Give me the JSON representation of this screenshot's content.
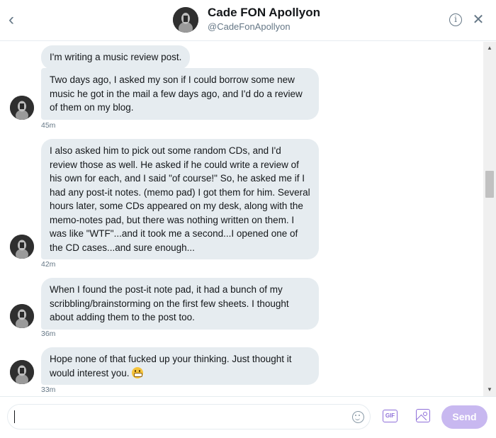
{
  "header": {
    "back_icon": "chevron-left-icon",
    "name": "Cade FON Apollyon",
    "handle": "@CadeFonApollyon",
    "info_icon": "info-icon",
    "close_icon": "close-icon"
  },
  "messages": [
    {
      "text": "I'm writing a music review post.",
      "time": ""
    },
    {
      "text": "Two days ago, I asked my son if I could borrow some new music he got in the mail a few days ago, and I'd do a review of them on my blog.",
      "time": "45m"
    },
    {
      "text": "I also asked him to pick out some random CDs, and I'd review those as well. He asked if he could write a review of his own for each, and I said \"of course!\" So, he asked me if I had any post-it notes. (memo pad) I got them for him. Several hours later, some CDs appeared on my desk, along with the memo-notes pad, but there was nothing written on them. I was like \"WTF\"...and it took me a second...I opened one of the CD cases...and sure enough...",
      "time": "42m"
    },
    {
      "text": "When I found the post-it note pad, it had a bunch of my scribbling/brainstorming on the first few sheets. I thought about adding them to the post too.",
      "time": "36m"
    },
    {
      "text": "Hope none of that fucked up your thinking. Just thought it would interest you.",
      "emoji": "grimacing-face-emoji",
      "time": "33m"
    }
  ],
  "composer": {
    "value": "",
    "placeholder": "",
    "emoji_icon": "smiley-icon",
    "gif_label": "GIF",
    "image_icon": "image-icon",
    "send_label": "Send"
  },
  "colors": {
    "bubble_bg": "#e6ecf0",
    "accent": "#8e6fd9",
    "send_disabled": "#c8b8f0",
    "muted_text": "#657786"
  }
}
